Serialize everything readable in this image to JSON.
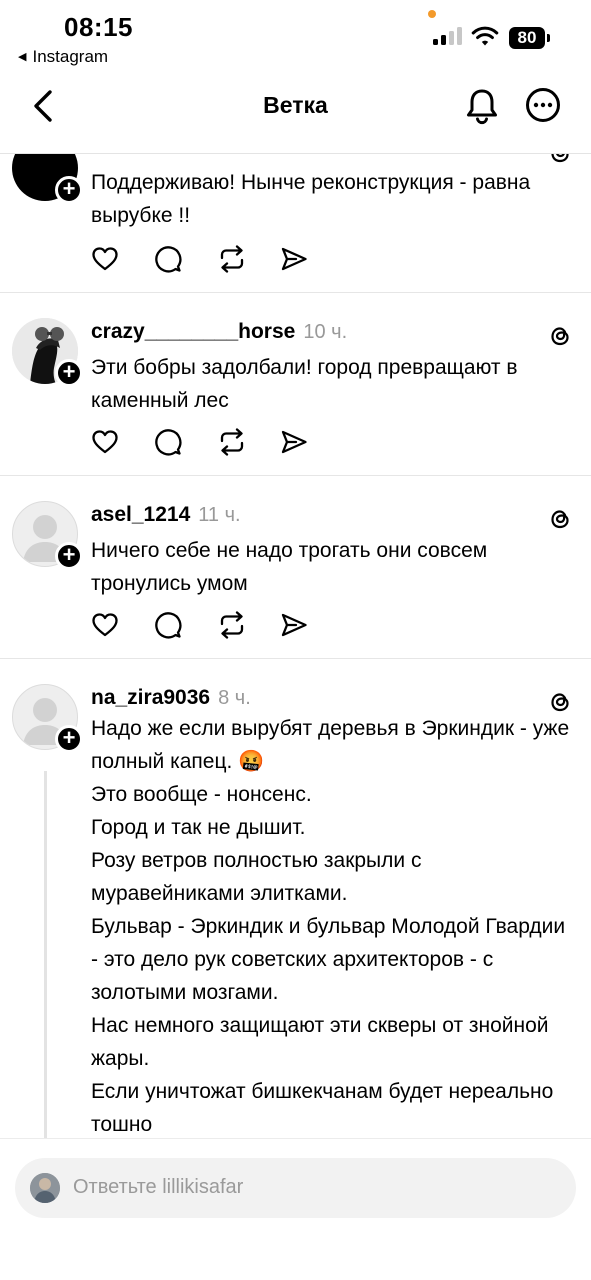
{
  "status_bar": {
    "time": "08:15",
    "back_app": "Instagram",
    "battery": "80"
  },
  "header": {
    "title": "Ветка",
    "icons": [
      "back-arrow-icon",
      "bell-icon",
      "more-icon"
    ]
  },
  "posts": [
    {
      "username": "",
      "time_ago": "",
      "text": [
        "Поддерживаю! Нынче реконструкция - равна вырубке !!"
      ]
    },
    {
      "username": "crazy________horse",
      "time_ago": "10 ч.",
      "text": [
        "Эти бобры задолбали! город превращают в каменный лес"
      ]
    },
    {
      "username": "asel_1214",
      "time_ago": "11 ч.",
      "text": [
        "Ничего себе не надо трогать они совсем тронулись умом"
      ]
    },
    {
      "username": "na_zira9036",
      "time_ago": "8 ч.",
      "text": [
        "Надо же если вырубят деревья в Эркиндик - уже полный капец. 🤬",
        "Это вообще - нонсенс.",
        "Город и так не дышит.",
        "Розу ветров полностью закрыли с муравейниками элитками.",
        "Бульвар - Эркиндик и бульвар Молодой Гвардии - это дело рук советских архитекторов - с золотыми мозгами.",
        "Нас немного защищают эти скверы от знойной жары.",
        "Если уничтожат бишкекчанам будет нереально тошно"
      ]
    }
  ],
  "action_icons": [
    "heart-icon",
    "comment-icon",
    "repost-icon",
    "share-icon"
  ],
  "reply": {
    "placeholder": "Ответьте lillikisafar"
  }
}
